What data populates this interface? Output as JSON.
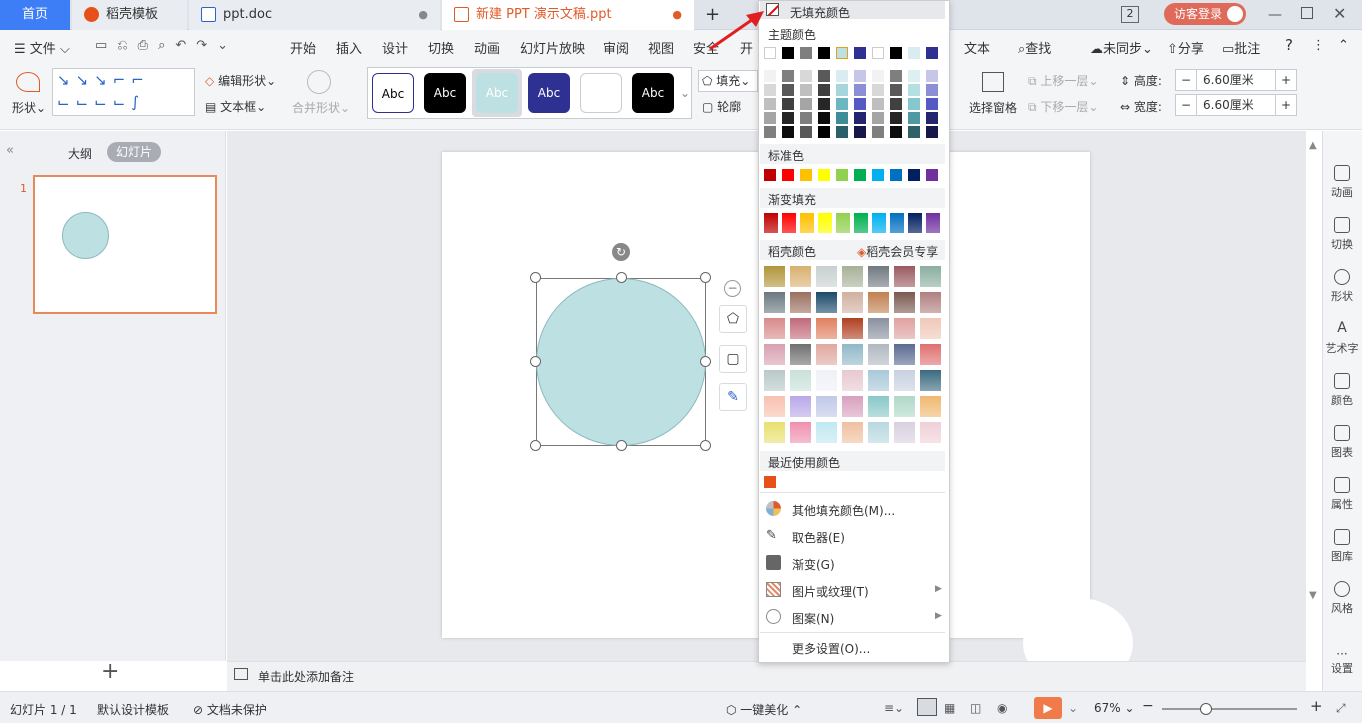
{
  "tabs": {
    "home": "首页",
    "template": "稻壳模板",
    "doc": "ppt.doc",
    "ppt": "新建 PPT 演示文稿.ppt",
    "new_tab": "+",
    "count_badge": "2",
    "login": "访客登录"
  },
  "menu": {
    "file": "文件",
    "items": [
      "开始",
      "插入",
      "设计",
      "切换",
      "动画",
      "幻灯片放映",
      "审阅",
      "视图",
      "安全",
      "开"
    ],
    "text_tool": "文本",
    "search": "查找",
    "sync": "未同步",
    "share": "分享",
    "comment": "批注",
    "help": "?"
  },
  "ribbon": {
    "shape": "形状",
    "edit_shape": "编辑形状",
    "text_box": "文本框",
    "merge_shape": "合并形状",
    "style_label": "Abc",
    "fill": "填充",
    "outline": "轮廓",
    "selection_pane": "选择窗格",
    "move_up": "上移一层",
    "move_down": "下移一层",
    "height_label": "高度:",
    "height_value": "6.60厘米",
    "width_label": "宽度:",
    "width_value": "6.60厘米"
  },
  "left_pane": {
    "outline_tab": "大纲",
    "slides_tab": "幻灯片",
    "slide_number": "1",
    "add": "+"
  },
  "notes": {
    "placeholder": "单击此处添加备注"
  },
  "right_bar": [
    "动画",
    "切换",
    "形状",
    "艺术字",
    "颜色",
    "图表",
    "属性",
    "图库",
    "风格",
    "设置"
  ],
  "status": {
    "slide": "幻灯片 1 / 1",
    "theme": "默认设计模板",
    "protect": "文档未保护",
    "beautify": "一键美化",
    "zoom": "67%"
  },
  "dropdown": {
    "no_fill": "无填充颜色",
    "theme_colors": "主题颜色",
    "standard_colors": "标准色",
    "gradient_fill": "渐变填充",
    "docer_colors": "稻壳颜色",
    "docer_vip": "稻壳会员专享",
    "recent_colors": "最近使用颜色",
    "more_fill": "其他填充颜色(M)...",
    "eyedropper": "取色器(E)",
    "gradient": "渐变(G)",
    "picture_texture": "图片或纹理(T)",
    "pattern": "图案(N)",
    "more_settings": "更多设置(O)...",
    "theme_top": [
      "#ffffff",
      "#000000",
      "#7f7f7f",
      "#000000",
      "#bfe0e3",
      "#2e3192",
      "#ffffff",
      "#000000",
      "#d9ecef",
      "#2e3192"
    ],
    "standard": [
      "#c00000",
      "#ff0000",
      "#ffc000",
      "#ffff00",
      "#92d050",
      "#00b050",
      "#00b0f0",
      "#0070c0",
      "#002060",
      "#7030a0"
    ],
    "recent": [
      "#e8501a"
    ],
    "shape_fill": "#bde0e3",
    "accent": "#e05a2a"
  }
}
